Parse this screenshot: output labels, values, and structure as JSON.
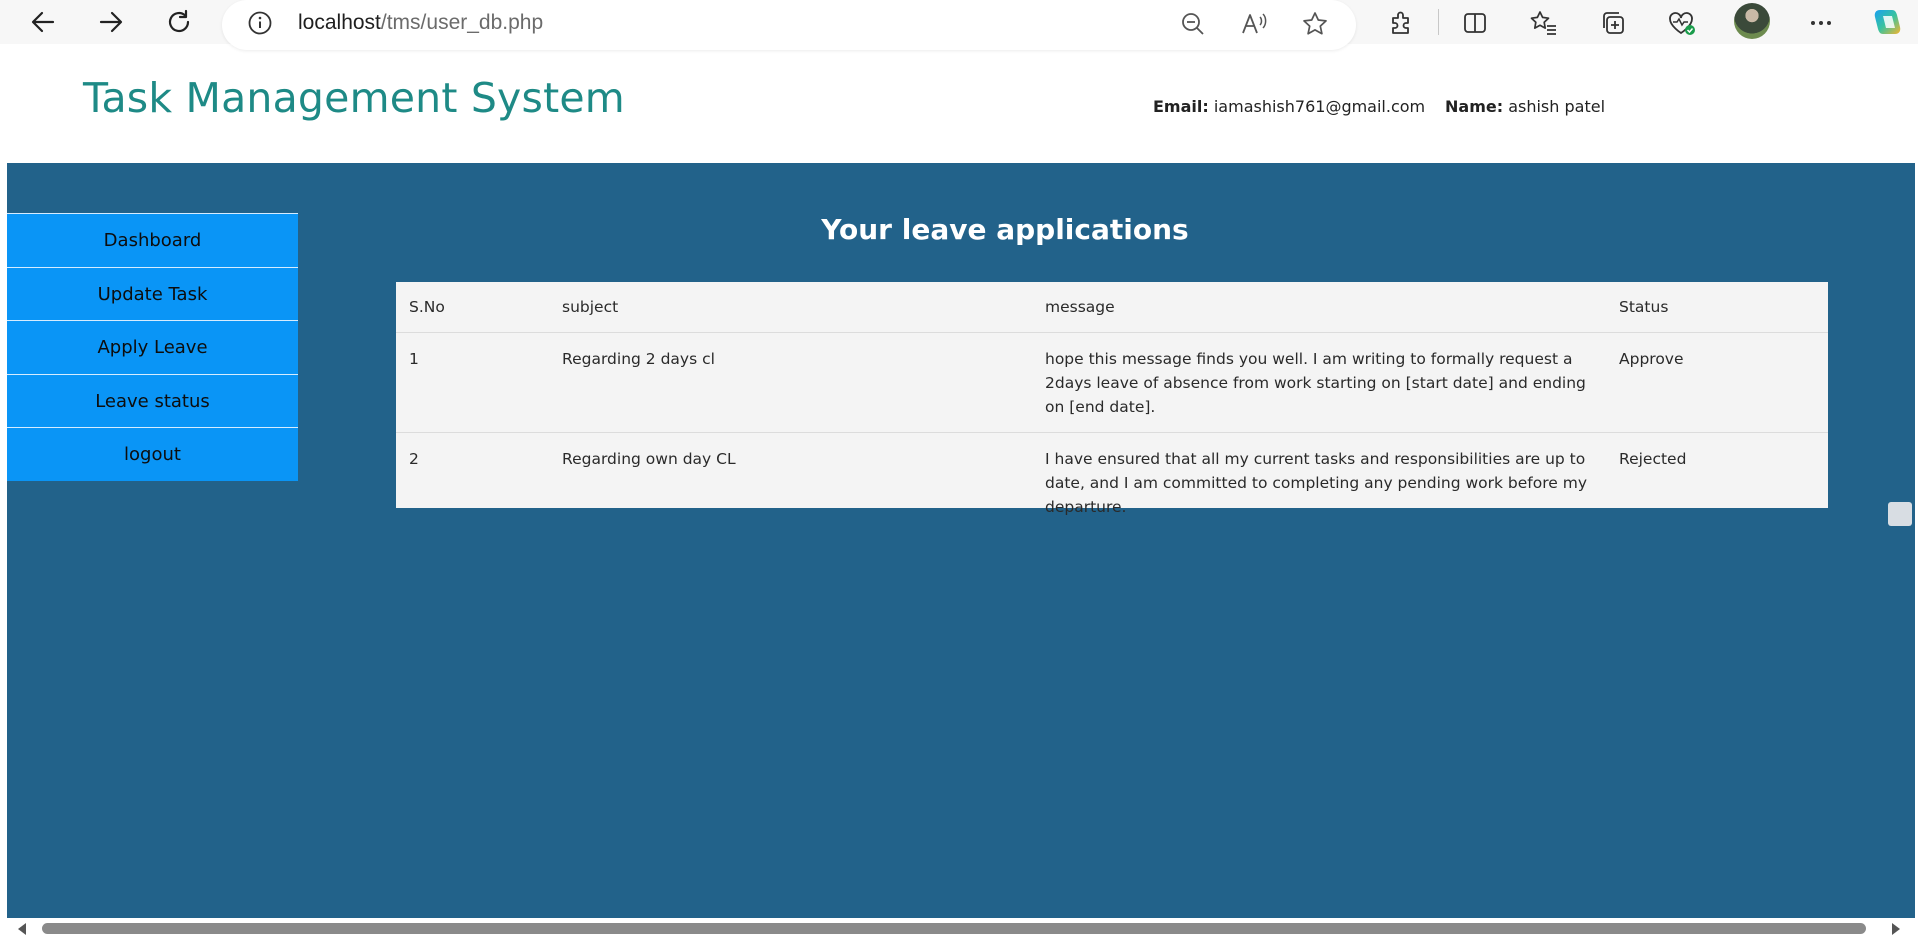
{
  "browser": {
    "url_host": "localhost",
    "url_path": "/tms/user_db.php"
  },
  "header": {
    "title": "Task Management System",
    "email_label": "Email:",
    "email_value": "iamashish761@gmail.com",
    "name_label": "Name:",
    "name_value": "ashish patel"
  },
  "sidebar": {
    "items": [
      {
        "label": "Dashboard"
      },
      {
        "label": "Update Task"
      },
      {
        "label": "Apply Leave"
      },
      {
        "label": "Leave status"
      },
      {
        "label": "logout"
      }
    ]
  },
  "main": {
    "title": "Your leave applications",
    "columns": [
      "S.No",
      "subject",
      "message",
      "Status"
    ],
    "rows": [
      {
        "sno": "1",
        "subject": "Regarding 2 days cl",
        "message": "hope this message finds you well. I am writing to formally request a 2days leave of absence from work starting on [start date] and ending on [end date].",
        "status": "Approve"
      },
      {
        "sno": "2",
        "subject": "Regarding own day CL",
        "message": "I have ensured that all my current tasks and responsibilities are up to date, and I am committed to completing any pending work before my departure.",
        "status": "Rejected"
      }
    ]
  },
  "colors": {
    "page_bg": "#22628a",
    "title": "#1e8a86",
    "sidebar_bg": "#0a95f6"
  },
  "icons": {
    "back": "back-arrow-icon",
    "forward": "forward-arrow-icon",
    "refresh": "refresh-icon",
    "info": "info-icon",
    "zoom_out": "zoom-out-icon",
    "read_aloud": "read-aloud-icon",
    "favorite": "star-icon",
    "extensions": "puzzle-icon",
    "split": "split-screen-icon",
    "favorites": "favorites-icon",
    "collections": "collections-icon",
    "health": "browser-essentials-icon",
    "more": "more-icon",
    "copilot": "copilot-icon"
  }
}
